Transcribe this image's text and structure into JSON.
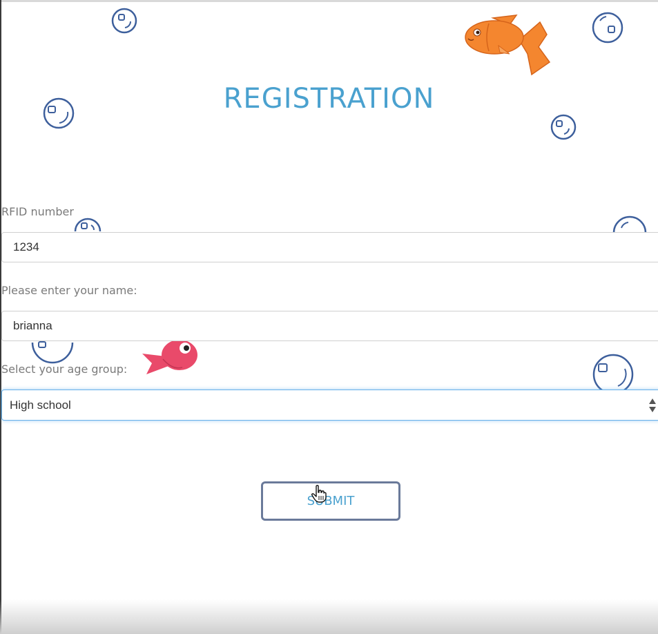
{
  "title": "REGISTRATION",
  "form": {
    "rfid_label": "RFID number",
    "rfid_value": "1234",
    "name_label": "Please enter your name:",
    "name_value": "brianna",
    "age_label": "Select your age group:",
    "age_selected": "High school",
    "submit_label": "SUBMIT"
  },
  "icons": {
    "bubbles": "bubble-icon",
    "orange_fish": "orange-fish-icon",
    "pink_fish": "pink-fish-icon",
    "cursor": "hand-pointer-icon",
    "select_arrows": "select-arrows-icon"
  },
  "colors": {
    "title": "#4aa1cf",
    "label": "#7a7a7a",
    "bubble_stroke": "#3d5f9c",
    "submit_border": "#6a7a9a",
    "select_focus": "#66afe9",
    "orange_fish": "#f4862f",
    "pink_fish": "#e94a6a"
  }
}
